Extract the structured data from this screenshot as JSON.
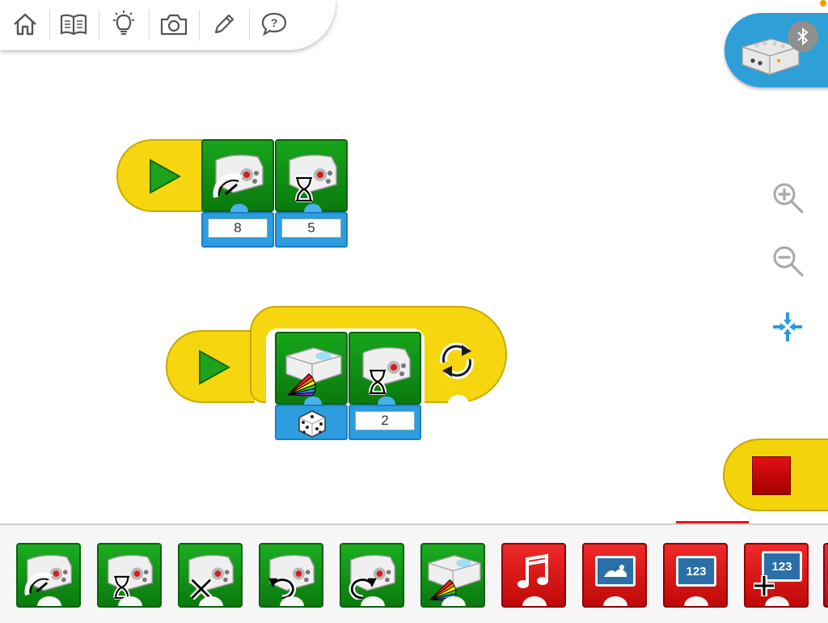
{
  "toolbar": {
    "items": [
      {
        "name": "home-icon"
      },
      {
        "name": "book-icon"
      },
      {
        "name": "lightbulb-icon"
      },
      {
        "name": "camera-icon"
      },
      {
        "name": "pencil-icon"
      },
      {
        "name": "help-icon"
      }
    ]
  },
  "hub": {
    "icon": "smarthub-icon",
    "status_icon": "bluetooth-icon"
  },
  "zoom": {
    "items": [
      "zoom-in-icon",
      "zoom-out-icon",
      "fit-icon"
    ]
  },
  "program1": {
    "blocks": [
      {
        "type": "start",
        "icon": "play-icon"
      },
      {
        "type": "motor-power",
        "icon": "motor-speed-icon",
        "input": "8"
      },
      {
        "type": "motor-on-for",
        "icon": "motor-hourglass-icon",
        "input": "5"
      }
    ]
  },
  "program2": {
    "blocks": [
      {
        "type": "start",
        "icon": "play-icon"
      },
      {
        "type": "light",
        "icon": "light-color-icon",
        "input_icon": "dice-icon"
      },
      {
        "type": "motor-on-for",
        "icon": "motor-hourglass-icon",
        "input": "2"
      },
      {
        "type": "repeat",
        "icon": "loop-icon"
      }
    ]
  },
  "stop": {
    "icon": "stop-icon"
  },
  "palette": {
    "blocks": [
      {
        "color": "green",
        "icon": "motor-speed-icon"
      },
      {
        "color": "green",
        "icon": "motor-hourglass-icon"
      },
      {
        "color": "green",
        "icon": "motor-off-icon"
      },
      {
        "color": "green",
        "icon": "motor-counterclockwise-icon"
      },
      {
        "color": "green",
        "icon": "motor-clockwise-icon"
      },
      {
        "color": "green",
        "icon": "light-color-icon"
      },
      {
        "color": "red",
        "icon": "music-note-icon"
      },
      {
        "color": "red",
        "icon": "display-background-icon"
      },
      {
        "color": "red",
        "icon": "display-number-icon",
        "text": "123"
      },
      {
        "color": "red",
        "icon": "display-add-number-icon",
        "text": "123"
      }
    ]
  },
  "colors": {
    "start_yellow": "#f5d60f",
    "motor_green": "#0a7a0e",
    "input_blue": "#2d9de0",
    "display_red": "#c00808",
    "hub_blue": "#2f9fd8"
  }
}
